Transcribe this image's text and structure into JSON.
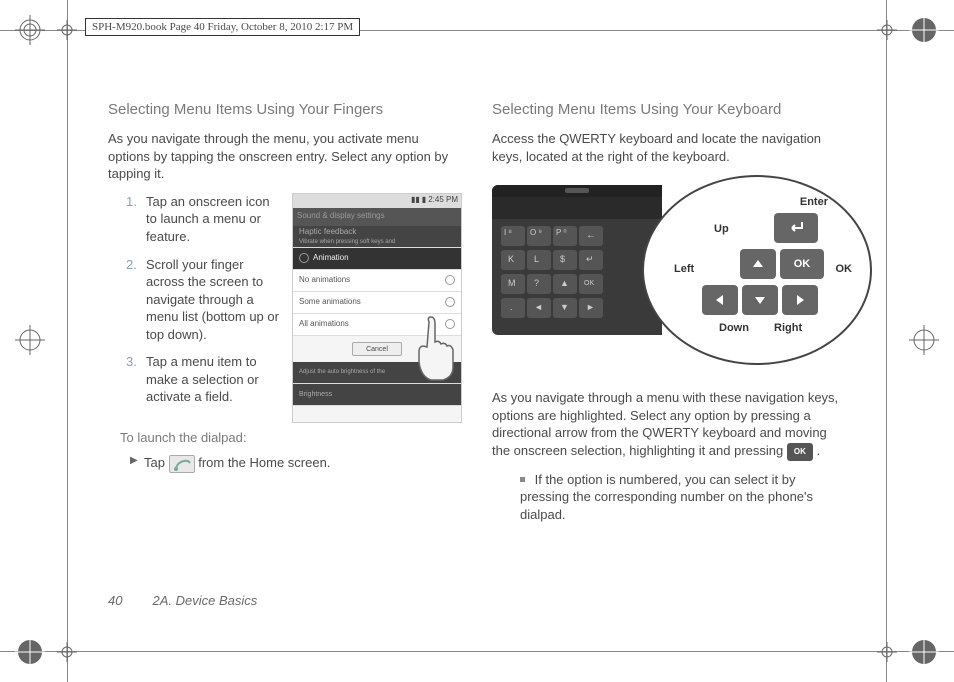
{
  "page_header": "SPH-M920.book  Page 40  Friday, October 8, 2010  2:17 PM",
  "left": {
    "heading": "Selecting Menu Items Using Your Fingers",
    "intro": "As you navigate through the menu, you activate menu options by tapping the onscreen entry. Select any option by tapping it.",
    "steps": [
      {
        "num": "1.",
        "text": "Tap an onscreen icon to launch a menu or feature."
      },
      {
        "num": "2.",
        "text": "Scroll your finger across the screen to navigate through a menu list (bottom up or top down)."
      },
      {
        "num": "3.",
        "text": "Tap a menu item to make a selection or activate a field."
      }
    ],
    "sub_heading": "To launch the dialpad:",
    "bullet_pre": "Tap ",
    "bullet_post": " from the Home screen.",
    "phone": {
      "status_time": "2:45 PM",
      "header": "Sound & display settings",
      "section1": "Haptic feedback",
      "section1_sub": "Vibrate when pressing soft keys and",
      "dialog_title": "Animation",
      "opt1": "No animations",
      "opt2": "Some animations",
      "opt3": "All animations",
      "cancel": "Cancel",
      "dim1": "Adjust the auto brightness of the",
      "dim2": "Brightness"
    }
  },
  "right": {
    "heading": "Selecting Menu Items Using Your Keyboard",
    "intro": "Access the QWERTY keyboard and locate the navigation keys, located at the right of the keyboard.",
    "labels": {
      "enter": "Enter",
      "up": "Up",
      "left": "Left",
      "ok": "OK",
      "down": "Down",
      "right": "Right",
      "ok_key": "OK"
    },
    "kb_symbols": {
      "row1": [
        "I ⁸",
        "O ⁹",
        "P ⁰",
        "←"
      ],
      "row2": [
        "K",
        "L",
        "$",
        "↵"
      ],
      "row3": [
        "M",
        "?",
        "▲",
        "OK"
      ],
      "row4": [
        ".",
        "◄",
        "▼",
        "►"
      ]
    },
    "para2_pre": "As you navigate through a menu with these navigation keys, options are highlighted. Select any option by pressing a directional arrow from the QWERTY keyboard and moving the onscreen selection, highlighting it and pressing ",
    "para2_post": " .",
    "bullet": "If the option is numbered, you can select it by pressing the corresponding number on the phone's dialpad.",
    "ok_inline": "OK"
  },
  "footer": {
    "page": "40",
    "section": "2A. Device Basics"
  }
}
